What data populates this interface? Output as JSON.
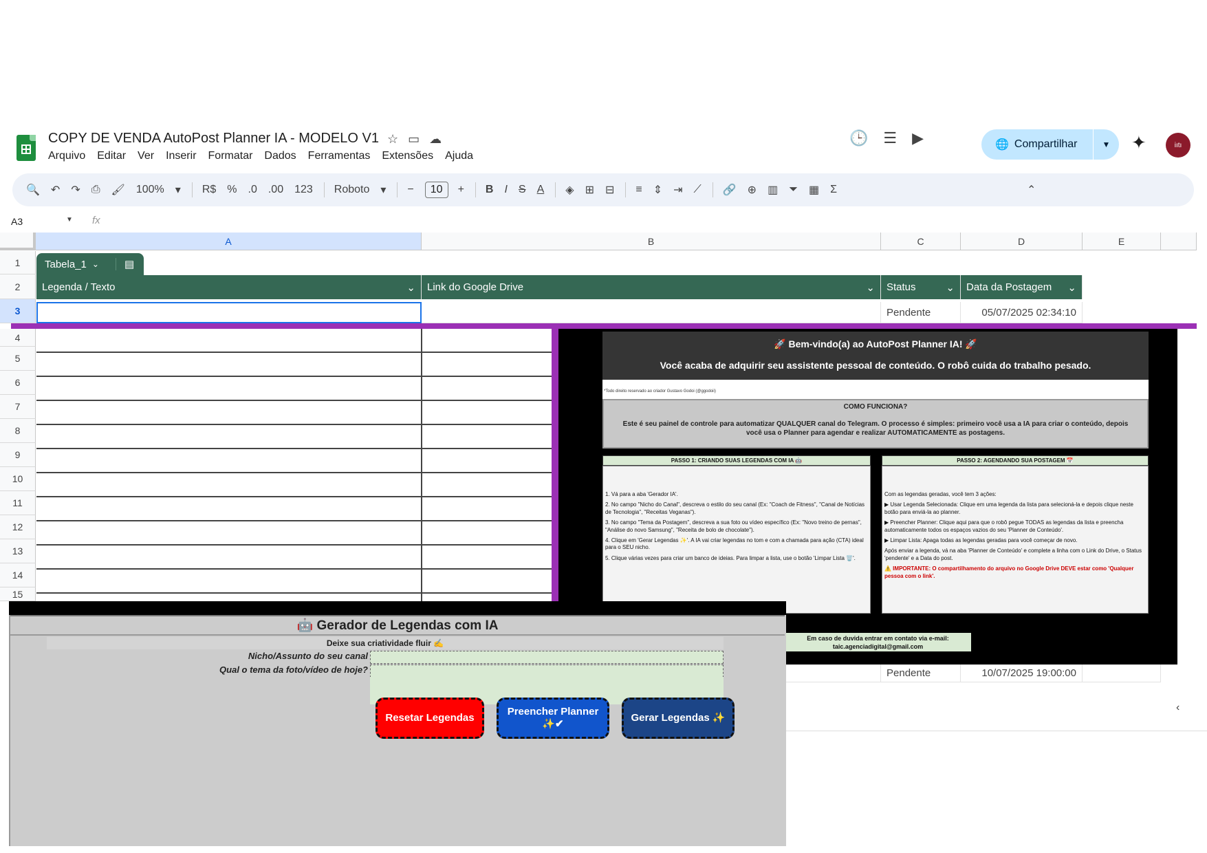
{
  "app": {
    "title": "COPY DE VENDA AutoPost Planner IA - MODELO V1",
    "menus": [
      "Arquivo",
      "Editar",
      "Ver",
      "Inserir",
      "Formatar",
      "Dados",
      "Ferramentas",
      "Extensões",
      "Ajuda"
    ],
    "share_label": "Compartilhar",
    "avatar_text": "iıtı"
  },
  "toolbar": {
    "zoom": "100%",
    "currency": "R$",
    "percent": "%",
    "dec_decrease": ".0",
    "dec_increase": ".00",
    "format_123": "123",
    "font": "Roboto",
    "font_size": "10"
  },
  "formula": {
    "cell_ref": "A3",
    "fx": "fx"
  },
  "columns": [
    "A",
    "B",
    "C",
    "D",
    "E"
  ],
  "rows": [
    "1",
    "2",
    "3",
    "4",
    "5",
    "6",
    "7",
    "8",
    "9",
    "10",
    "11",
    "12",
    "13",
    "14",
    "15"
  ],
  "table": {
    "tab_name": "Tabela_1",
    "headers": [
      "Legenda / Texto",
      "Link do Google Drive",
      "Status",
      "Data da Postagem"
    ],
    "row3": {
      "status": "Pendente",
      "date": "05/07/2025 02:34:10"
    },
    "lower_row": {
      "status": "Pendente",
      "date": "10/07/2025 19:00:00"
    }
  },
  "panel": {
    "welcome_title": "🚀 Bem-vindo(a) ao AutoPost Planner IA! 🚀",
    "welcome_sub": "Você acaba de adquirir seu assistente pessoal de conteúdo. O robô cuida do trabalho pesado.",
    "rights": "*Todo direito reservado ao criador Gustavo Godoi (@ggodoii)",
    "como_title": "COMO FUNCIONA?",
    "como_body": "Este é seu painel de controle para automatizar QUALQUER canal do Telegram. O processo é simples: primeiro você usa a IA para criar o conteúdo, depois você usa o Planner para agendar e realizar AUTOMATICAMENTE as postagens.",
    "passo1_title": "PASSO 1: CRIANDO SUAS LEGENDAS COM IA 🤖",
    "passo1_items": [
      "1. Vá para a aba 'Gerador IA'.",
      "2. No campo \"Nicho do Canal\", descreva o estilo do seu canal (Ex: \"Coach de Fitness\", \"Canal de Notícias de Tecnologia\", \"Receitas Veganas\").",
      "3. No campo \"Tema da Postagem\", descreva a sua foto ou vídeo específico (Ex: \"Novo treino de pernas\", \"Análise do novo Samsung\", \"Receita de bolo de chocolate\").",
      "4. Clique em 'Gerar Legendas ✨'. A IA vai criar legendas no tom e com a chamada para ação (CTA) ideal para o SEU nicho.",
      "5. Clique várias vezes para criar um banco de ideias. Para limpar a lista, use o botão 'Limpar Lista 🗑️'."
    ],
    "passo2_title": "PASSO 2: AGENDANDO SUA POSTAGEM 📅",
    "passo2_items": [
      "Com as legendas geradas, você tem 3 ações:",
      "▶ Usar Legenda Selecionada: Clique em uma legenda da lista para selecioná-la e depois clique neste botão para enviá-la ao planner.",
      "▶ Preencher Planner: Clique aqui para que o robô pegue TODAS as legendas da lista e preencha automaticamente todos os espaços vazios do seu 'Planner de Conteúdo'.",
      "▶ Limpar Lista: Apaga todas as legendas geradas para você começar de novo.",
      "Após enviar a legenda, vá na aba 'Planner de Conteúdo' e complete a linha com o Link do Drive, o Status 'pendente' e a Data do post."
    ],
    "passo2_warning": "⚠️ IMPORTANTE: O compartilhamento do arquivo no Google Drive DEVE estar como 'Qualquer pessoa com o link'.",
    "contact_line1": "Em caso de duvida entrar em contato via e-mail:",
    "contact_line2": "taic.agenciadigital@gmail.com"
  },
  "generator": {
    "title": "🤖 Gerador de Legendas com IA",
    "subtitle": "Deixe sua criatividade fluir ✍️",
    "label_nicho": "Nicho/Assunto do seu canal",
    "label_tema": "Qual o tema da foto/vídeo de hoje?",
    "btn_reset": "Resetar Legendas",
    "btn_fill": "Preencher Planner ✨✔",
    "btn_generate": "Gerar Legendas ✨"
  },
  "colors": {
    "header_green": "#356854",
    "purple": "#9b30b5",
    "btn_red": "#ff0000",
    "btn_blue": "#1155cc",
    "btn_navy": "#1c4587"
  }
}
